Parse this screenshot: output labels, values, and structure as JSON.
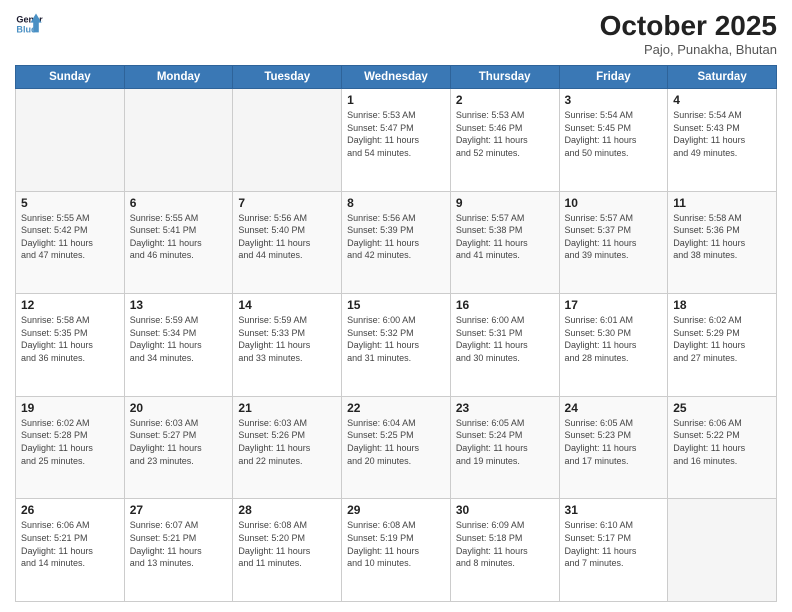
{
  "header": {
    "logo_line1": "General",
    "logo_line2": "Blue",
    "month": "October 2025",
    "location": "Pajo, Punakha, Bhutan"
  },
  "weekdays": [
    "Sunday",
    "Monday",
    "Tuesday",
    "Wednesday",
    "Thursday",
    "Friday",
    "Saturday"
  ],
  "weeks": [
    [
      {
        "day": "",
        "info": ""
      },
      {
        "day": "",
        "info": ""
      },
      {
        "day": "",
        "info": ""
      },
      {
        "day": "1",
        "info": "Sunrise: 5:53 AM\nSunset: 5:47 PM\nDaylight: 11 hours\nand 54 minutes."
      },
      {
        "day": "2",
        "info": "Sunrise: 5:53 AM\nSunset: 5:46 PM\nDaylight: 11 hours\nand 52 minutes."
      },
      {
        "day": "3",
        "info": "Sunrise: 5:54 AM\nSunset: 5:45 PM\nDaylight: 11 hours\nand 50 minutes."
      },
      {
        "day": "4",
        "info": "Sunrise: 5:54 AM\nSunset: 5:43 PM\nDaylight: 11 hours\nand 49 minutes."
      }
    ],
    [
      {
        "day": "5",
        "info": "Sunrise: 5:55 AM\nSunset: 5:42 PM\nDaylight: 11 hours\nand 47 minutes."
      },
      {
        "day": "6",
        "info": "Sunrise: 5:55 AM\nSunset: 5:41 PM\nDaylight: 11 hours\nand 46 minutes."
      },
      {
        "day": "7",
        "info": "Sunrise: 5:56 AM\nSunset: 5:40 PM\nDaylight: 11 hours\nand 44 minutes."
      },
      {
        "day": "8",
        "info": "Sunrise: 5:56 AM\nSunset: 5:39 PM\nDaylight: 11 hours\nand 42 minutes."
      },
      {
        "day": "9",
        "info": "Sunrise: 5:57 AM\nSunset: 5:38 PM\nDaylight: 11 hours\nand 41 minutes."
      },
      {
        "day": "10",
        "info": "Sunrise: 5:57 AM\nSunset: 5:37 PM\nDaylight: 11 hours\nand 39 minutes."
      },
      {
        "day": "11",
        "info": "Sunrise: 5:58 AM\nSunset: 5:36 PM\nDaylight: 11 hours\nand 38 minutes."
      }
    ],
    [
      {
        "day": "12",
        "info": "Sunrise: 5:58 AM\nSunset: 5:35 PM\nDaylight: 11 hours\nand 36 minutes."
      },
      {
        "day": "13",
        "info": "Sunrise: 5:59 AM\nSunset: 5:34 PM\nDaylight: 11 hours\nand 34 minutes."
      },
      {
        "day": "14",
        "info": "Sunrise: 5:59 AM\nSunset: 5:33 PM\nDaylight: 11 hours\nand 33 minutes."
      },
      {
        "day": "15",
        "info": "Sunrise: 6:00 AM\nSunset: 5:32 PM\nDaylight: 11 hours\nand 31 minutes."
      },
      {
        "day": "16",
        "info": "Sunrise: 6:00 AM\nSunset: 5:31 PM\nDaylight: 11 hours\nand 30 minutes."
      },
      {
        "day": "17",
        "info": "Sunrise: 6:01 AM\nSunset: 5:30 PM\nDaylight: 11 hours\nand 28 minutes."
      },
      {
        "day": "18",
        "info": "Sunrise: 6:02 AM\nSunset: 5:29 PM\nDaylight: 11 hours\nand 27 minutes."
      }
    ],
    [
      {
        "day": "19",
        "info": "Sunrise: 6:02 AM\nSunset: 5:28 PM\nDaylight: 11 hours\nand 25 minutes."
      },
      {
        "day": "20",
        "info": "Sunrise: 6:03 AM\nSunset: 5:27 PM\nDaylight: 11 hours\nand 23 minutes."
      },
      {
        "day": "21",
        "info": "Sunrise: 6:03 AM\nSunset: 5:26 PM\nDaylight: 11 hours\nand 22 minutes."
      },
      {
        "day": "22",
        "info": "Sunrise: 6:04 AM\nSunset: 5:25 PM\nDaylight: 11 hours\nand 20 minutes."
      },
      {
        "day": "23",
        "info": "Sunrise: 6:05 AM\nSunset: 5:24 PM\nDaylight: 11 hours\nand 19 minutes."
      },
      {
        "day": "24",
        "info": "Sunrise: 6:05 AM\nSunset: 5:23 PM\nDaylight: 11 hours\nand 17 minutes."
      },
      {
        "day": "25",
        "info": "Sunrise: 6:06 AM\nSunset: 5:22 PM\nDaylight: 11 hours\nand 16 minutes."
      }
    ],
    [
      {
        "day": "26",
        "info": "Sunrise: 6:06 AM\nSunset: 5:21 PM\nDaylight: 11 hours\nand 14 minutes."
      },
      {
        "day": "27",
        "info": "Sunrise: 6:07 AM\nSunset: 5:21 PM\nDaylight: 11 hours\nand 13 minutes."
      },
      {
        "day": "28",
        "info": "Sunrise: 6:08 AM\nSunset: 5:20 PM\nDaylight: 11 hours\nand 11 minutes."
      },
      {
        "day": "29",
        "info": "Sunrise: 6:08 AM\nSunset: 5:19 PM\nDaylight: 11 hours\nand 10 minutes."
      },
      {
        "day": "30",
        "info": "Sunrise: 6:09 AM\nSunset: 5:18 PM\nDaylight: 11 hours\nand 8 minutes."
      },
      {
        "day": "31",
        "info": "Sunrise: 6:10 AM\nSunset: 5:17 PM\nDaylight: 11 hours\nand 7 minutes."
      },
      {
        "day": "",
        "info": ""
      }
    ]
  ]
}
